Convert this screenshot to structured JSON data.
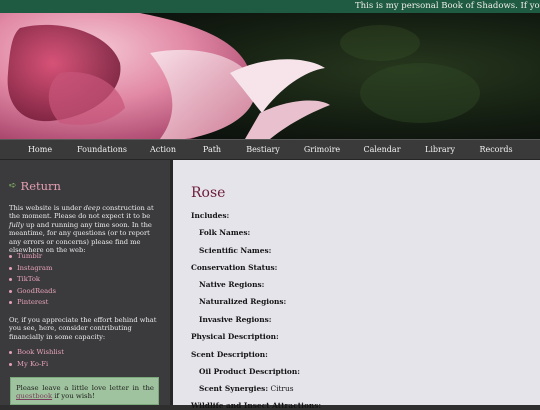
{
  "marquee": {
    "text": "This is my personal Book of Shadows. If you find it u"
  },
  "nav": {
    "items": [
      "Home",
      "Foundations",
      "Action",
      "Path",
      "Bestiary",
      "Grimoire",
      "Calendar",
      "Library",
      "Records"
    ]
  },
  "sidebar": {
    "return_label": "Return",
    "intro_pre": "This website is under ",
    "intro_em1": "deep",
    "intro_mid": " construction at the moment. Please do not expect it to be ",
    "intro_em2": "fully",
    "intro_post": " up and running any time soon. In the meantime, for any questions (or to report any errors or concerns) please find me elsewhere on the web:",
    "social_links": [
      "Tumblr",
      "Instagram",
      "TikTok",
      "GoodReads",
      "Pinterest"
    ],
    "support_text": "Or, if you appreciate the effort behind what you see, here, consider contributing financially in some capacity:",
    "support_links": [
      "Book Wishlist",
      "My Ko-Fi"
    ],
    "notice_pre": "Please leave a little love letter in the ",
    "notice_link": "guestbook",
    "notice_post": " if you wish!"
  },
  "content": {
    "title": "Rose",
    "rows": [
      {
        "label": "Includes:",
        "value": ""
      },
      {
        "label": "Folk Names:",
        "value": ""
      },
      {
        "label": "Scientific Names:",
        "value": ""
      },
      {
        "label": "Conservation Status:",
        "value": ""
      },
      {
        "label": "Native Regions:",
        "value": ""
      },
      {
        "label": "Naturalized Regions:",
        "value": ""
      },
      {
        "label": "Invasive Regions:",
        "value": ""
      },
      {
        "label": "Physical Description:",
        "value": ""
      },
      {
        "label": "Scent Description:",
        "value": ""
      },
      {
        "label": "Oil Product Description:",
        "value": ""
      },
      {
        "label": "Scent Synergies:",
        "value": "Citrus"
      },
      {
        "label": "Wildlife and Insect Attractions:",
        "value": ""
      }
    ]
  },
  "colors": {
    "marquee_bg": "#1f5b43",
    "title": "#6c1d39",
    "sidebar_link": "#e7a2b7",
    "notice_bg": "#9fc39e"
  },
  "icons": {
    "return": "arrow-left-icon"
  }
}
